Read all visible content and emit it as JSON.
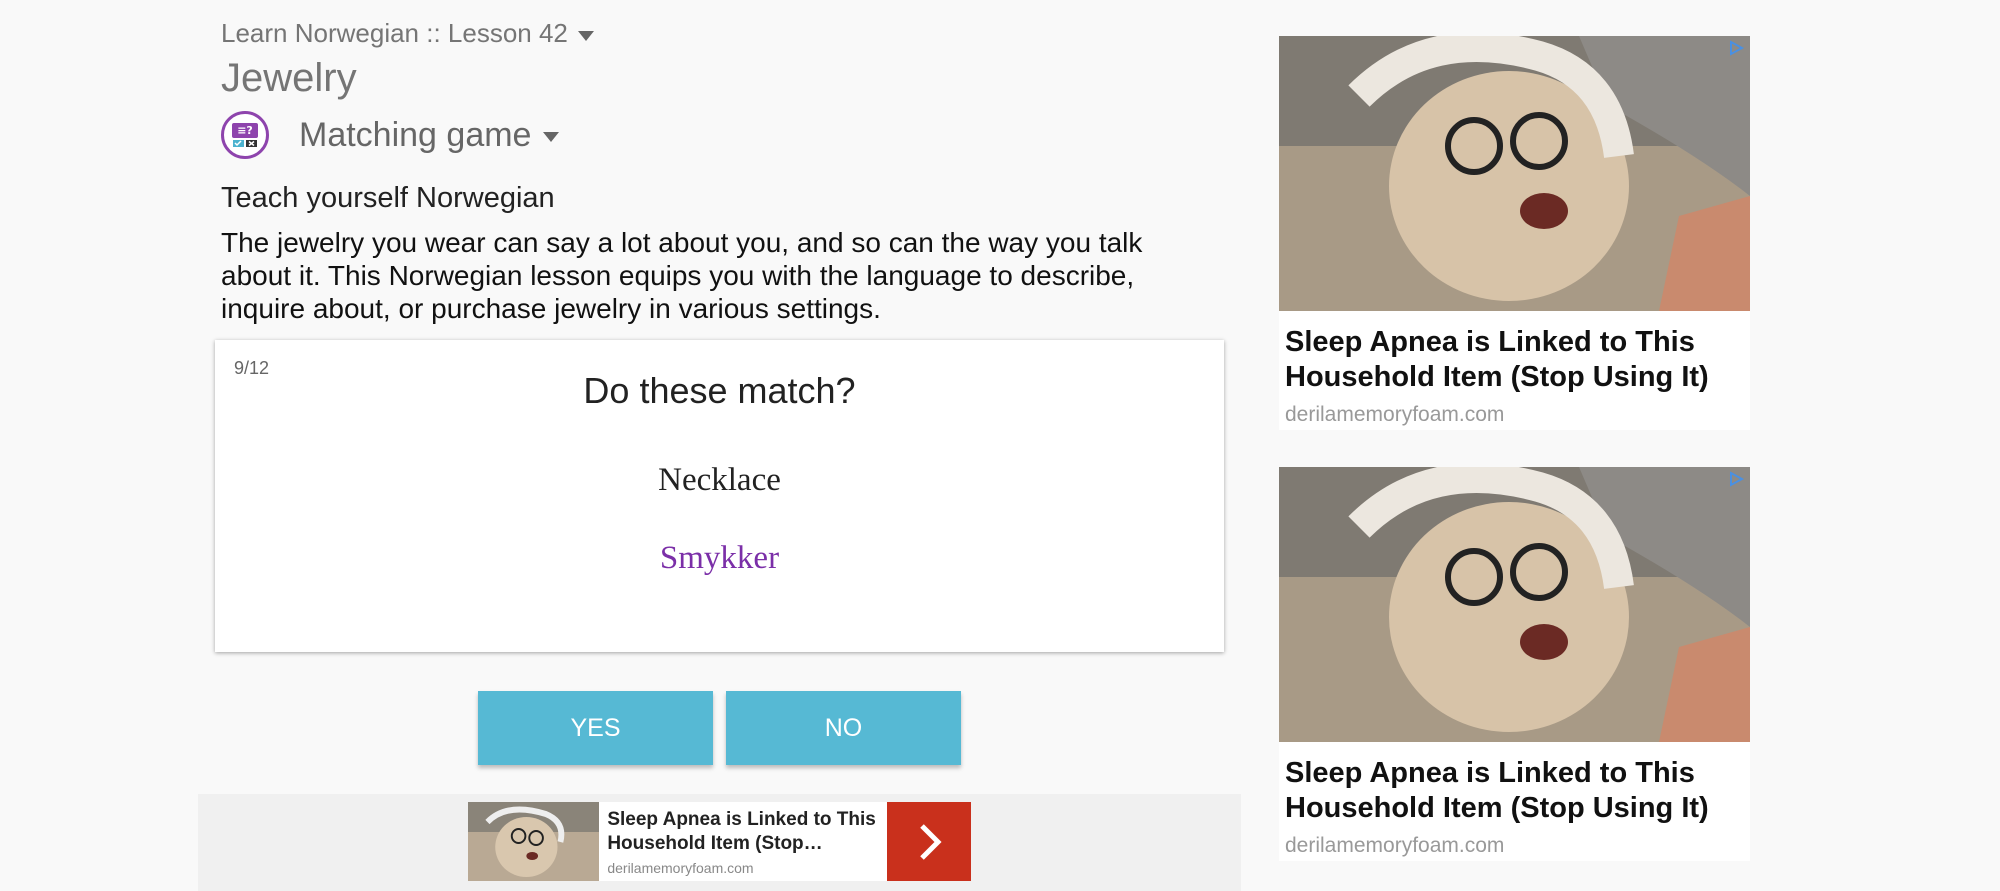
{
  "breadcrumb": {
    "label": "Learn Norwegian :: Lesson 42"
  },
  "lesson": {
    "title": "Jewelry",
    "game_mode": "Matching game",
    "subtitle": "Teach yourself Norwegian",
    "description": "The jewelry you wear can say a lot about you, and so can the way you talk about it. This Norwegian lesson equips you with the language to describe, inquire about, or purchase jewelry in various settings."
  },
  "game": {
    "progress": "9/12",
    "question": "Do these match?",
    "english_word": "Necklace",
    "norwegian_word": "Smykker",
    "yes_label": "YES",
    "no_label": "NO"
  },
  "bottom_ad": {
    "headline": "Sleep Apnea is Linked to This Household Item (Stop…",
    "domain": "derilamemoryfoam.com"
  },
  "side_ads": [
    {
      "headline": "Sleep Apnea is Linked to This Household Item (Stop Using It)",
      "domain": "derilamemoryfoam.com"
    },
    {
      "headline": "Sleep Apnea is Linked to This Household Item (Stop Using It)",
      "domain": "derilamemoryfoam.com"
    }
  ],
  "colors": {
    "button": "#56b9d4",
    "accent_purple": "#7b2fa8",
    "ad_arrow": "#c9301c"
  },
  "icons": {
    "game": "matching-game-icon",
    "dropdown": "triangle-down-icon",
    "ad_arrow": "chevron-right-icon",
    "ad_choice": "adchoices-icon"
  }
}
